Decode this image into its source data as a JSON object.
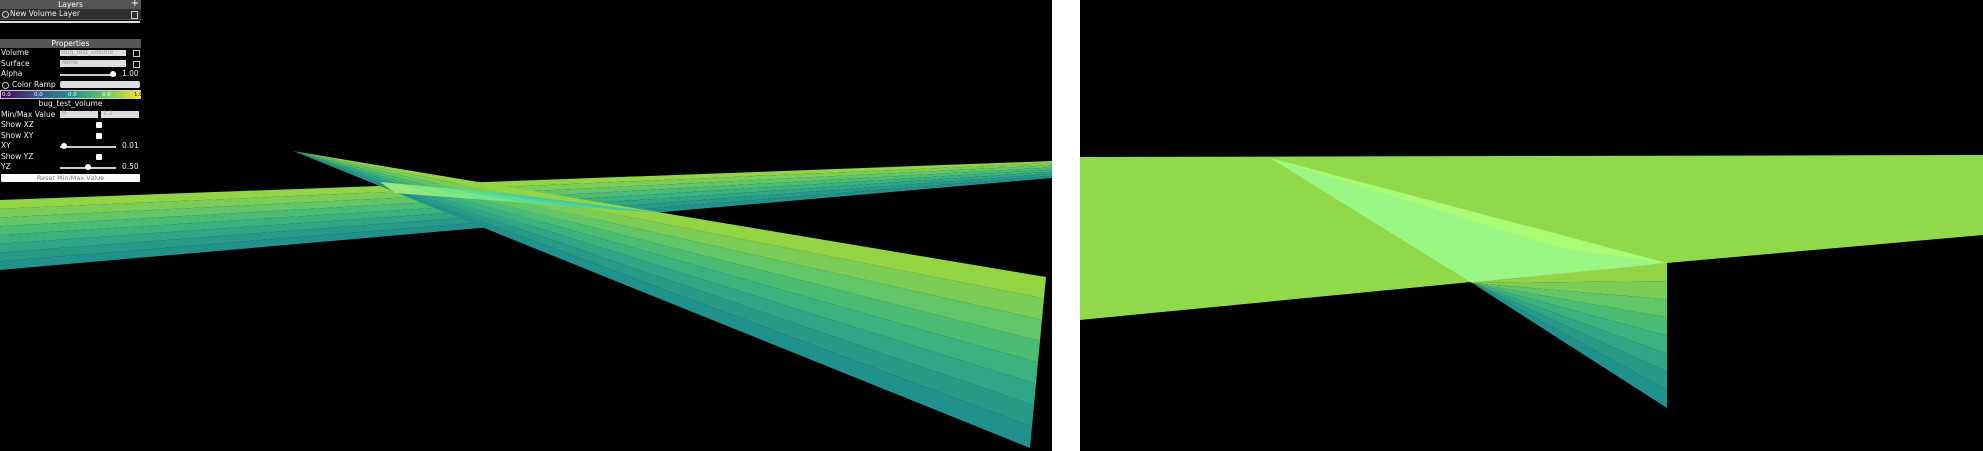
{
  "gui": {
    "layers_title": "Layers",
    "layer_name": "New Volume Layer",
    "properties_title": "Properties",
    "volume_label": "Volume",
    "volume_value": "bug_test_volume",
    "surface_label": "Surface",
    "surface_value": "None",
    "alpha_label": "Alpha",
    "alpha_value": "1.00",
    "alpha_level": 1.0,
    "color_ramp_label": "Color Ramp",
    "colorbar_ticks": [
      "0.0",
      "0.0",
      "0.0",
      "0.0",
      "1.0"
    ],
    "volume_name": "bug_test_volume",
    "minmax_label": "Min/Max Value",
    "min_value": "0",
    "max_value": "1.2",
    "show_xz_label": "Show XZ",
    "show_xy_label": "Show XY",
    "xy_label": "XY",
    "xy_value": "0.01",
    "xy_level": 0.01,
    "show_yz_label": "Show YZ",
    "yz_label": "YZ",
    "yz_value": "0.50",
    "yz_level": 0.5,
    "reset_label": "Reset Min/Max Value"
  },
  "colors": {
    "viewport_bg": "#000000",
    "divider": "#ffffff",
    "ramp": [
      "#21918c",
      "#2a9a88",
      "#2fa685",
      "#3ab17e",
      "#4cbb74",
      "#62c568",
      "#7bcd58",
      "#93d445"
    ],
    "ramp_bright": [
      "#30c7b0",
      "#40d5a8",
      "#55e0a0",
      "#72ea93",
      "#8ff087",
      "#aaf47b"
    ],
    "plane_right": "#8fd94a",
    "plane_right_bright": "#9cfa8a"
  }
}
